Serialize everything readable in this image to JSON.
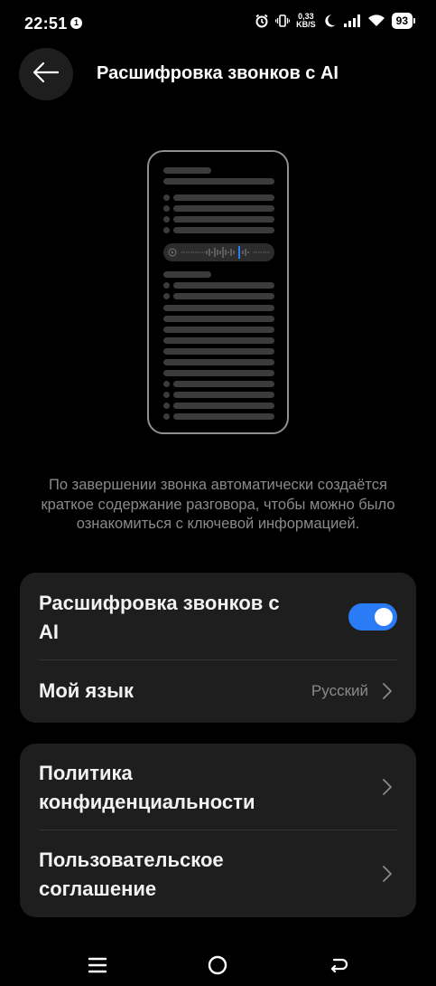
{
  "status_bar": {
    "time": "22:51",
    "notification_count": "1",
    "speed_value": "0,33",
    "speed_unit": "KB/S",
    "battery": "93"
  },
  "header": {
    "title": "Расшифровка звонков с AI",
    "back_icon": "arrow-left-icon"
  },
  "description": "По завершении звонка автоматически создаётся краткое содержание разговора, чтобы можно было ознакомиться с ключевой информацией.",
  "settings_card": {
    "transcription_label_line1": "Расшифровка звонков с",
    "transcription_label_line2": "AI",
    "transcription_enabled": true,
    "language_label": "Мой язык",
    "language_value": "Русский"
  },
  "legal_card": {
    "privacy_line1": "Политика",
    "privacy_line2": "конфиденциальности",
    "agreement_line1": "Пользовательское",
    "agreement_line2": "соглашение"
  },
  "nav": {
    "menu_icon": "menu-icon",
    "home_icon": "home-circle-icon",
    "back_icon": "back-arrow-icon"
  },
  "colors": {
    "background": "#000000",
    "card": "#1e1e1e",
    "accent": "#2a7cf6",
    "secondary_text": "#8a8a8a"
  }
}
